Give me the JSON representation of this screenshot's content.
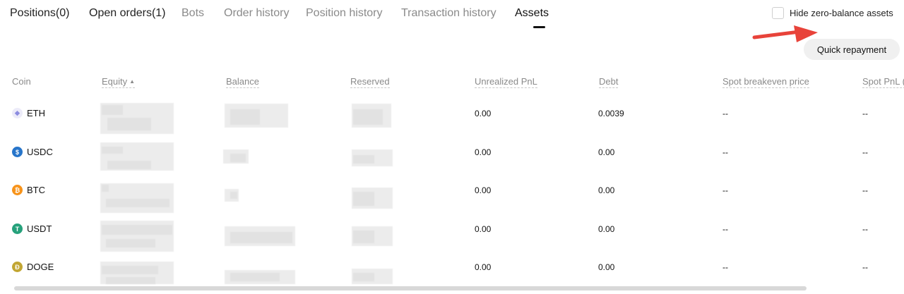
{
  "tabs": [
    {
      "label": "Positions(0)"
    },
    {
      "label": "Open orders(1)"
    },
    {
      "label": "Bots"
    },
    {
      "label": "Order history"
    },
    {
      "label": "Position history"
    },
    {
      "label": "Transaction history"
    },
    {
      "label": "Assets"
    }
  ],
  "active_tab": "Assets",
  "hide_zero": {
    "label": "Hide zero-balance assets",
    "checked": false
  },
  "quick_repayment_label": "Quick repayment",
  "columns": {
    "coin": "Coin",
    "equity": "Equity",
    "balance": "Balance",
    "reserved": "Reserved",
    "unrealized": "Unrealized PnL",
    "debt": "Debt",
    "spot_breakeven": "Spot breakeven price",
    "spot_pnl": "Spot PnL ("
  },
  "rows": [
    {
      "coin": "ETH",
      "unrealized": "0.00",
      "debt": "0.0039",
      "spot_breakeven": "--",
      "spot_pnl": "--"
    },
    {
      "coin": "USDC",
      "unrealized": "0.00",
      "debt": "0.00",
      "spot_breakeven": "--",
      "spot_pnl": "--"
    },
    {
      "coin": "BTC",
      "unrealized": "0.00",
      "debt": "0.00",
      "spot_breakeven": "--",
      "spot_pnl": "--"
    },
    {
      "coin": "USDT",
      "unrealized": "0.00",
      "debt": "0.00",
      "spot_breakeven": "--",
      "spot_pnl": "--"
    },
    {
      "coin": "DOGE",
      "unrealized": "0.00",
      "debt": "0.00",
      "spot_breakeven": "--",
      "spot_pnl": "--"
    }
  ],
  "coin_icons": {
    "ETH": {
      "name": "ethereum-icon",
      "color": "#ecebf9",
      "glyph": "◆"
    },
    "USDC": {
      "name": "usdc-icon",
      "color": "#2775ca",
      "glyph": "$"
    },
    "BTC": {
      "name": "bitcoin-icon",
      "color": "#f7931a",
      "glyph": "₿"
    },
    "USDT": {
      "name": "tether-icon",
      "color": "#26a17b",
      "glyph": "T"
    },
    "DOGE": {
      "name": "dogecoin-icon",
      "color": "#c2a633",
      "glyph": "Ð"
    }
  },
  "colors": {
    "arrow": "#e8433a",
    "active_tab": "#111111",
    "inactive_tab": "#8a8a8a"
  }
}
